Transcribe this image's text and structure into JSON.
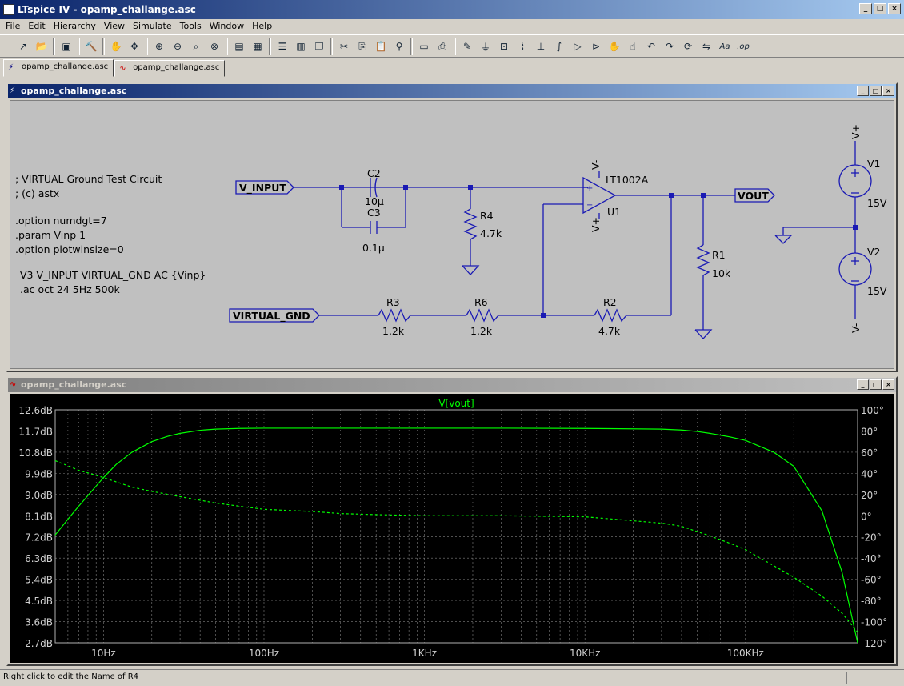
{
  "app": {
    "title": "LTspice IV - opamp_challange.asc"
  },
  "menu": [
    "File",
    "Edit",
    "Hierarchy",
    "View",
    "Simulate",
    "Tools",
    "Window",
    "Help"
  ],
  "toolbar_icons": [
    "run-icon",
    "open-icon",
    "save-icon",
    "control-panel-icon",
    "halt-icon",
    "pan-icon",
    "zoom-in-icon",
    "zoom-out-icon",
    "zoom-fit-icon",
    "zoom-cancel-icon",
    "autorange-icon",
    "grid-icon",
    "tile-horizontal-icon",
    "tile-vertical-icon",
    "cascade-icon",
    "cut-icon",
    "copy-icon",
    "paste-icon",
    "find-icon",
    "print-setup-icon",
    "print-icon",
    "wire-icon",
    "ground-icon",
    "label-icon",
    "resistor-icon",
    "capacitor-icon",
    "inductor-icon",
    "diode-icon",
    "component-icon",
    "move-icon",
    "drag-icon",
    "undo-icon",
    "redo-icon",
    "rotate-icon",
    "mirror-icon",
    "text-icon",
    "spice-directive-icon"
  ],
  "tabs": [
    {
      "label": "opamp_challange.asc",
      "icon": "schematic-icon"
    },
    {
      "label": "opamp_challange.asc",
      "icon": "waveform-icon"
    }
  ],
  "schematic": {
    "title": "opamp_challange.asc",
    "comments": [
      "; VIRTUAL Ground Test Circuit",
      "; (c) astx"
    ],
    "directives": [
      ".option numdgt=7",
      ".param Vinp 1",
      ".option plotwinsize=0"
    ],
    "source_line": "V3 V_INPUT VIRTUAL_GND AC {Vinp}",
    "ac_line": ".ac oct 24 5Hz 500k",
    "labels": {
      "v_input": "V_INPUT",
      "virtual_gnd": "VIRTUAL_GND",
      "vout": "VOUT",
      "vplus": "V+",
      "vminus": "V-"
    },
    "components": {
      "c2_name": "C2",
      "c2_value": "10µ",
      "c3_name": "C3",
      "c3_value": "0.1µ",
      "r4_name": "R4",
      "r4_value": "4.7k",
      "r1_name": "R1",
      "r1_value": "10k",
      "r3_name": "R3",
      "r3_value": "1.2k",
      "r6_name": "R6",
      "r6_value": "1.2k",
      "r2_name": "R2",
      "r2_value": "4.7k",
      "u1_name": "U1",
      "u1_model": "LT1002A",
      "opamp_vminus": "V-",
      "opamp_vplus": "V+",
      "v1_name": "V1",
      "v1_value": "15V",
      "v2_name": "V2",
      "v2_value": "15V"
    }
  },
  "waveform": {
    "title": "opamp_challange.asc",
    "trace_label": "V[vout]",
    "trace_color": "#00ff00",
    "background": "#000000"
  },
  "chart_data": {
    "type": "line",
    "title": "V[vout]",
    "x_scale": "log",
    "xlim": [
      5,
      500000
    ],
    "x_ticks": [
      {
        "value": 10,
        "label": "10Hz"
      },
      {
        "value": 100,
        "label": "100Hz"
      },
      {
        "value": 1000,
        "label": "1KHz"
      },
      {
        "value": 10000,
        "label": "10KHz"
      },
      {
        "value": 100000,
        "label": "100KHz"
      }
    ],
    "y_left_ticks": [
      "12.6dB",
      "11.7dB",
      "10.8dB",
      "9.9dB",
      "9.0dB",
      "8.1dB",
      "7.2dB",
      "6.3dB",
      "5.4dB",
      "4.5dB",
      "3.6dB",
      "2.7dB"
    ],
    "y_left_range": [
      2.7,
      12.6
    ],
    "y_right_ticks": [
      "100°",
      "80°",
      "60°",
      "40°",
      "20°",
      "0°",
      "-20°",
      "-40°",
      "-60°",
      "-80°",
      "-100°",
      "-120°"
    ],
    "y_right_range": [
      -120,
      100
    ],
    "grid": true,
    "series": [
      {
        "name": "V[vout]",
        "kind": "magnitude",
        "style": "solid",
        "x": [
          5,
          6,
          7,
          8,
          10,
          12,
          15,
          20,
          25,
          30,
          40,
          50,
          70,
          100,
          150,
          200,
          300,
          500,
          1000,
          3000,
          10000,
          30000,
          40000,
          50000,
          60000,
          70000,
          80000,
          100000,
          150000,
          200000,
          300000,
          400000,
          500000
        ],
        "y": [
          7.28,
          7.95,
          8.5,
          8.96,
          9.72,
          10.28,
          10.79,
          11.25,
          11.47,
          11.6,
          11.73,
          11.78,
          11.81,
          11.82,
          11.82,
          11.82,
          11.82,
          11.82,
          11.82,
          11.82,
          11.81,
          11.78,
          11.74,
          11.68,
          11.6,
          11.52,
          11.45,
          11.3,
          10.8,
          10.2,
          8.3,
          5.7,
          2.7
        ]
      },
      {
        "name": "V[vout]",
        "kind": "phase",
        "style": "dashed",
        "x": [
          5,
          7,
          10,
          15,
          20,
          30,
          50,
          70,
          100,
          200,
          300,
          500,
          1000,
          3000,
          10000,
          30000,
          40000,
          50000,
          60000,
          80000,
          100000,
          200000,
          300000,
          400000,
          500000
        ],
        "y": [
          52,
          43,
          36,
          27,
          23,
          18,
          12,
          9,
          6,
          4,
          2,
          1,
          0,
          0,
          -1,
          -7,
          -10,
          -15,
          -19,
          -26,
          -32,
          -58,
          -76,
          -92,
          -110
        ]
      }
    ]
  },
  "statusbar": {
    "text": "Right click to edit the Name of R4"
  }
}
